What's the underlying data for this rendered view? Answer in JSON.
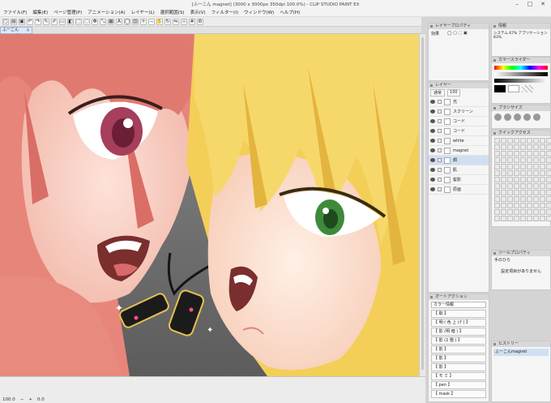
{
  "title": "[ふーこん magnet] (3000 x 3000px 350dpi 100.0%)  - CLIP STUDIO PAINT EX",
  "window_controls": [
    "–",
    "□",
    "✕"
  ],
  "menu": [
    "ファイル(F)",
    "編集(E)",
    "ページ管理(P)",
    "アニメーション(A)",
    "レイヤー(L)",
    "選択範囲(S)",
    "表示(V)",
    "フィルター(I)",
    "ウィンドウ(W)",
    "ヘルプ(H)"
  ],
  "doc_tab": {
    "label": "ふーこんmagnet",
    "close": "×"
  },
  "layer_property": {
    "title": "レイヤープロパティ",
    "effect_label": "効果"
  },
  "info_panel": {
    "title": "情報",
    "text": "システム 67%  アプリケーション 83%"
  },
  "color_panel": {
    "title": "カラースライダー"
  },
  "layer_panel": {
    "title": "レイヤー",
    "blend_mode": "通常",
    "opacity": "100",
    "layers": [
      {
        "name": "光",
        "selected": false
      },
      {
        "name": "スクリーン",
        "selected": false
      },
      {
        "name": "コード",
        "selected": false
      },
      {
        "name": "コード",
        "selected": false
      },
      {
        "name": "white",
        "selected": false
      },
      {
        "name": "magnet",
        "selected": false
      },
      {
        "name": "顔",
        "selected": true
      },
      {
        "name": "肌",
        "selected": false
      },
      {
        "name": "髪影",
        "selected": false
      },
      {
        "name": "原画",
        "selected": false
      }
    ]
  },
  "subtool_panel": {
    "title": "ブラシサイズ"
  },
  "quick_access": {
    "title": "クイックアクセス"
  },
  "tool_property": {
    "title": "ツールプロパティ",
    "subtitle": "手のひら",
    "empty": "設定項目がありません"
  },
  "auto_action": {
    "title": "オートアクション",
    "set": "カラー情報",
    "items": [
      "【 取 】",
      "【 明 ( 色 上 げ ) 】",
      "【 影 (明 暗 ) 】",
      "【 影 (2 階 ) 】",
      "【 影 】",
      "【 影 】",
      "【 影 】",
      "【 モ ミ 】",
      "【 pen 】",
      "【 mask 】"
    ]
  },
  "history": {
    "title": "ヒストリー",
    "item": "ふーこんmagnet"
  },
  "status": {
    "zoom": "100.0",
    "angle": "0.0"
  },
  "colors": {
    "accent": "#3b7fd0",
    "hair_pink": "#e8857a",
    "hair_gold": "#f3cf58"
  }
}
